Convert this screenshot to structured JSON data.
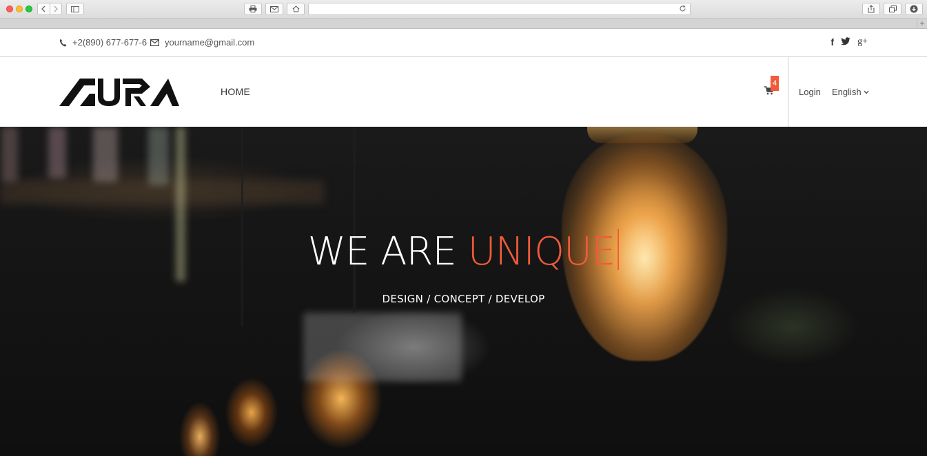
{
  "topbar": {
    "phone": "+2(890) 677-677-6",
    "email": "yourname@gmail.com",
    "social": [
      "f",
      "t",
      "g+"
    ]
  },
  "header": {
    "nav": [
      "HOME"
    ],
    "cart_count": "4",
    "login": "Login",
    "language": "English"
  },
  "hero": {
    "title_prefix": "WE ARE ",
    "title_accent": "UNIQUE",
    "subtitle": "DESIGN / CONCEPT / DEVELOP"
  },
  "colors": {
    "accent": "#f15a3a",
    "text_dark": "#333333",
    "hero_text": "#ffffff"
  },
  "icons": [
    "phone-icon",
    "envelope-icon",
    "facebook-icon",
    "twitter-icon",
    "google-plus-icon",
    "cart-icon",
    "chevron-down-icon"
  ]
}
